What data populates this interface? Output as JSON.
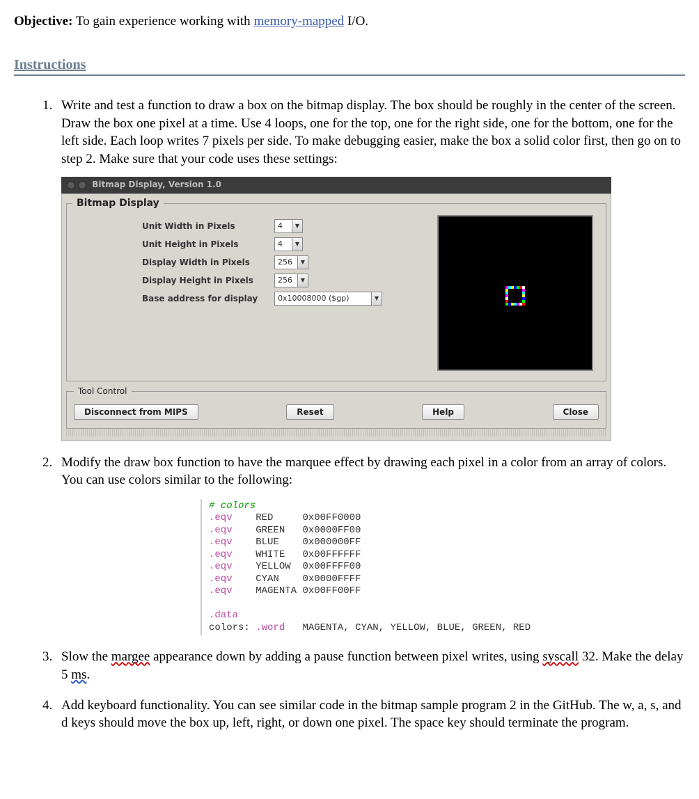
{
  "objective": {
    "label": "Objective:",
    "pre": "  To gain experience working with ",
    "link": "memory-mapped",
    "post": " I/O."
  },
  "instructions_heading": "Instructions",
  "steps": {
    "s1": "Write and test a function to draw a box on the bitmap display. The box should be roughly in the center of the screen. Draw the box one pixel at a time. Use 4 loops, one for the top, one for the right side, one for the bottom, one for the left side. Each loop writes 7 pixels per side. To make debugging easier, make the box a solid color first, then go on to step 2. Make sure that your code uses these settings:",
    "s2": "Modify the draw box function to have the marquee effect by drawing each pixel in a color from an array of colors. You can use colors similar to the following:",
    "s3_a": "Slow the ",
    "s3_margee": "margee",
    "s3_b": " appearance down by adding a pause function between pixel writes, using ",
    "s3_syscall": "syscall",
    "s3_c": " 32. Make the delay 5 ",
    "s3_ms": "ms",
    "s3_d": ".",
    "s4": "Add keyboard functionality. You can see similar code in the bitmap sample program 2 in the GitHub. The w, a, s, and d keys should move the box up, left, right, or down one pixel. The space key should terminate the program."
  },
  "bmp": {
    "titlebar": "Bitmap Display, Version 1.0",
    "legend": "Bitmap Display",
    "labels": {
      "unit_w": "Unit Width in Pixels",
      "unit_h": "Unit Height in Pixels",
      "disp_w": "Display Width in Pixels",
      "disp_h": "Display Height in Pixels",
      "base": "Base address for display"
    },
    "values": {
      "unit_w": "4",
      "unit_h": "4",
      "disp_w": "256",
      "disp_h": "256",
      "base": "0x10008000 ($gp)"
    },
    "tool_legend": "Tool Control",
    "buttons": {
      "disconnect": "Disconnect from MIPS",
      "reset": "Reset",
      "help": "Help",
      "close": "Close"
    }
  },
  "code": {
    "comment": "# colors",
    "eqv": ".eqv",
    "data": ".data",
    "word": ".word",
    "defs": [
      {
        "name": "RED",
        "val": "0x00FF0000"
      },
      {
        "name": "GREEN",
        "val": "0x0000FF00"
      },
      {
        "name": "BLUE",
        "val": "0x000000FF"
      },
      {
        "name": "WHITE",
        "val": "0x00FFFFFF"
      },
      {
        "name": "YELLOW",
        "val": "0x00FFFF00"
      },
      {
        "name": "CYAN",
        "val": "0x0000FFFF"
      },
      {
        "name": "MAGENTA",
        "val": "0x00FF00FF"
      }
    ],
    "array_label": "colors:",
    "array_vals": "MAGENTA, CYAN, YELLOW, BLUE, GREEN, RED"
  },
  "marquee_colors": [
    "#ff00ff",
    "#00ffff",
    "#ffff00",
    "#0000ff",
    "#00ff00",
    "#ff0000",
    "#ffffff"
  ]
}
